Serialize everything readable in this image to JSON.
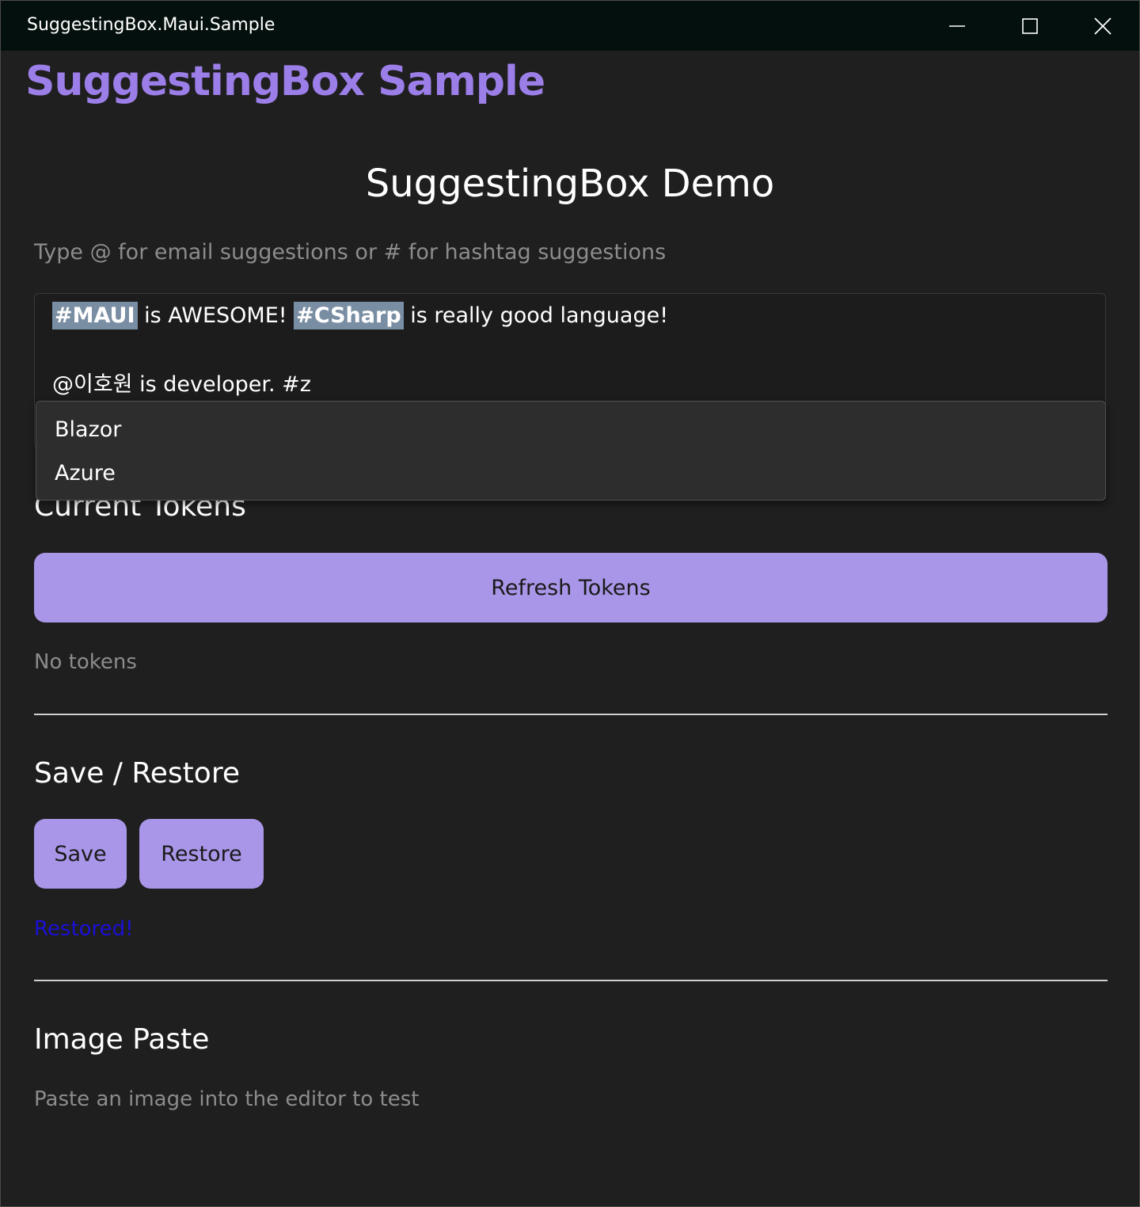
{
  "window": {
    "title": "SuggestingBox.Maui.Sample",
    "controls": [
      "minimize-icon",
      "maximize-icon",
      "close-icon"
    ]
  },
  "app": {
    "title": "SuggestingBox Sample"
  },
  "demo": {
    "heading": "SuggestingBox Demo",
    "hint": "Type @ for email suggestions or # for hashtag suggestions"
  },
  "editor": {
    "line1": {
      "token1": "#MAUI",
      "text1": " is AWESOME! ",
      "token2": "#CSharp",
      "text2": " is really good language!"
    },
    "line2": "@이호원 is developer. #z"
  },
  "suggestions": {
    "items": [
      "Blazor",
      "Azure"
    ]
  },
  "tokens": {
    "heading": "Current Tokens",
    "refresh_label": "Refresh Tokens",
    "status": "No tokens"
  },
  "save_restore": {
    "heading": "Save / Restore",
    "save_label": "Save",
    "restore_label": "Restore",
    "status": "Restored!"
  },
  "image_paste": {
    "heading": "Image Paste",
    "hint": "Paste an image into the editor to test"
  },
  "colors": {
    "accent": "#9c7ee8",
    "button": "#a996e8",
    "token_highlight": "#7a8ea3",
    "status_text": "#1b10d6",
    "background": "#1f1f1f"
  }
}
